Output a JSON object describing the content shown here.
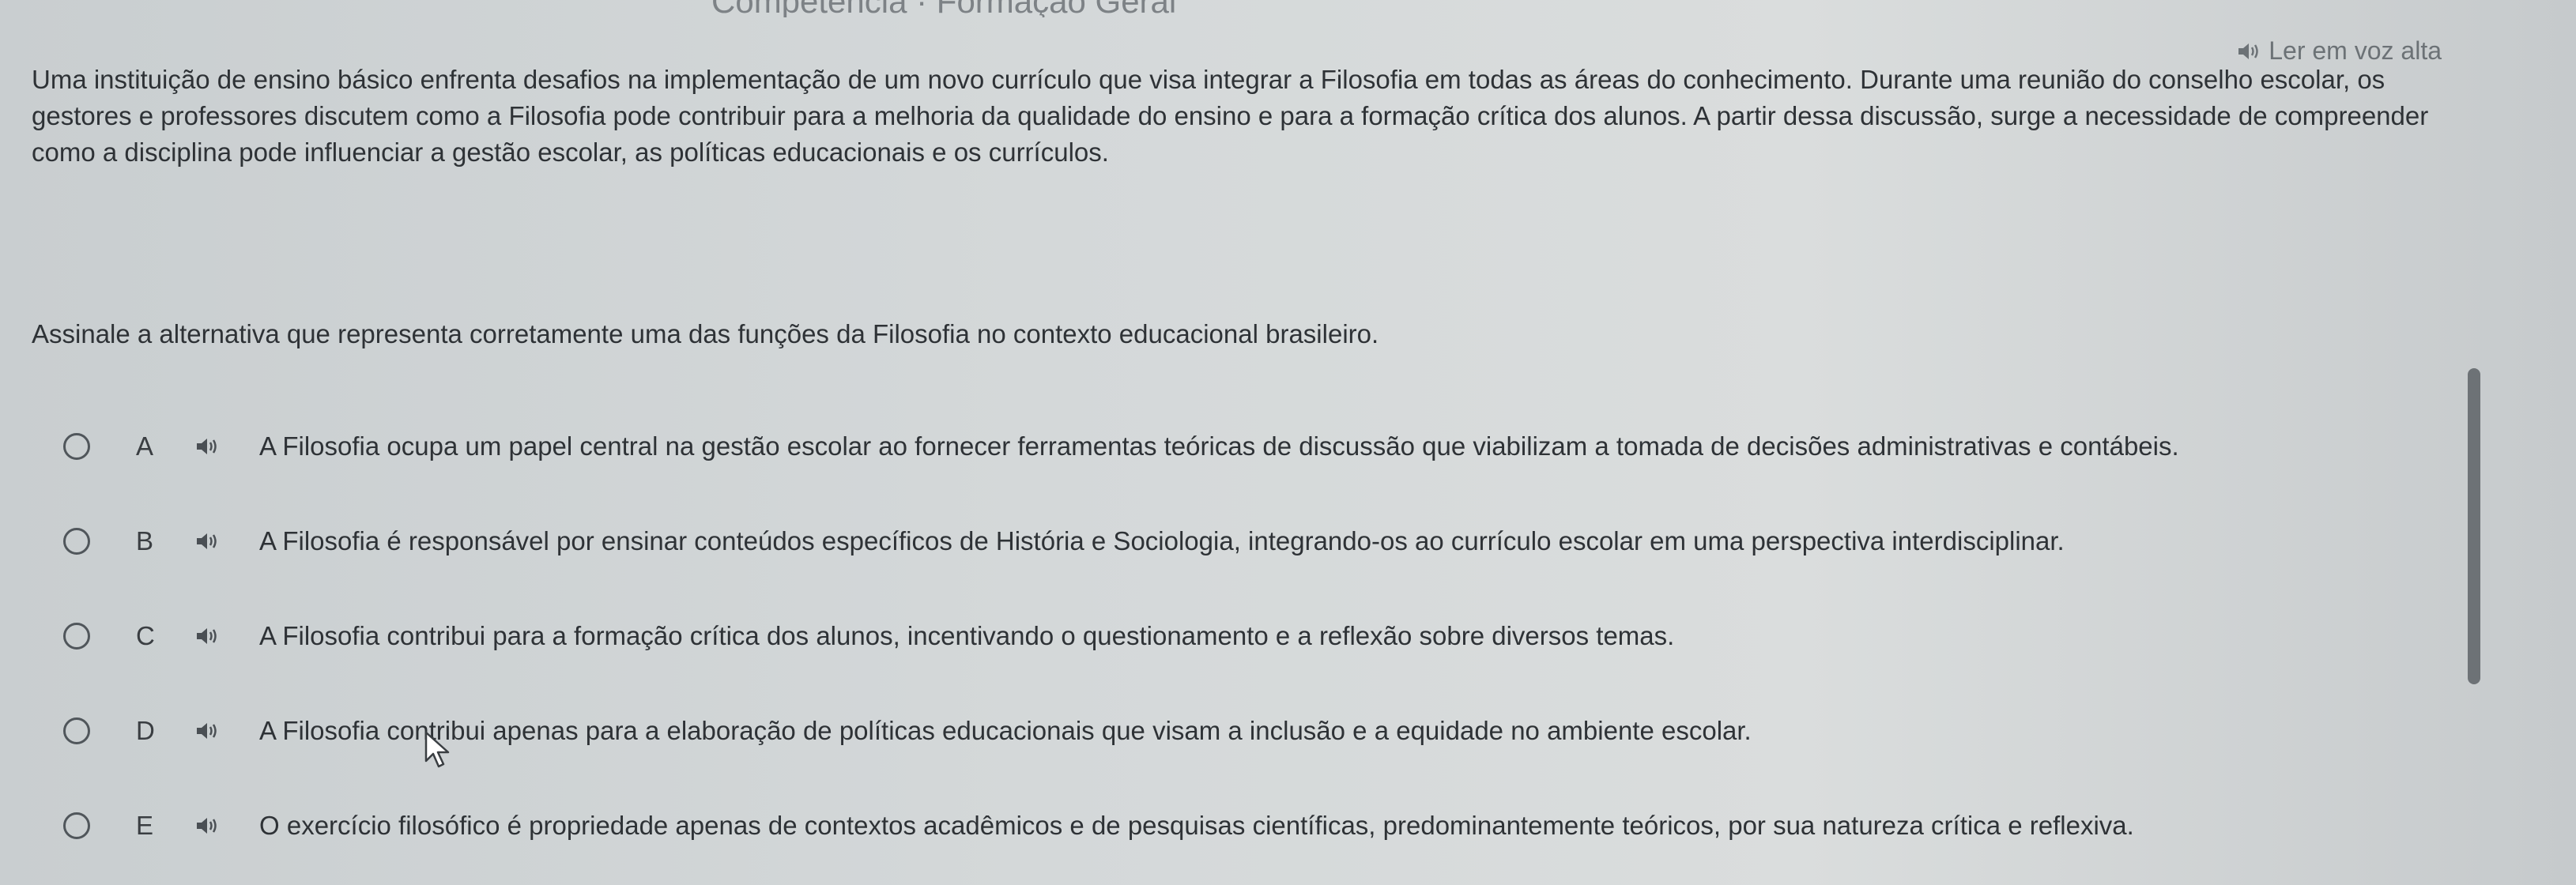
{
  "header": {
    "breadcrumb": "Competência · Formação Geral",
    "read_aloud_label": "Ler em voz alta"
  },
  "question": {
    "statement": "Uma instituição de ensino básico enfrenta desafios na implementação de um novo currículo que visa integrar a Filosofia em todas as áreas do conhecimento. Durante uma reunião do conselho escolar, os gestores e professores discutem como a Filosofia pode contribuir para a melhoria da qualidade do ensino e para a formação crítica dos alunos. A partir dessa discussão, surge a necessidade de compreender como a disciplina pode influenciar a gestão escolar, as políticas educacionais e os currículos.",
    "prompt": "Assinale a alternativa que representa corretamente uma das funções da Filosofia no contexto educacional brasileiro."
  },
  "options": [
    {
      "letter": "A",
      "text": "A Filosofia ocupa um papel central na gestão escolar ao fornecer ferramentas teóricas de discussão que viabilizam a tomada de decisões administrativas e contábeis."
    },
    {
      "letter": "B",
      "text": "A Filosofia é responsável por ensinar conteúdos específicos de História e Sociologia, integrando-os ao currículo escolar em uma perspectiva interdisciplinar."
    },
    {
      "letter": "C",
      "text": "A Filosofia contribui para a formação crítica dos alunos, incentivando o questionamento e a reflexão sobre diversos temas."
    },
    {
      "letter": "D",
      "text": "A Filosofia contribui apenas para a elaboração de políticas educacionais que visam a inclusão e a equidade no ambiente escolar."
    },
    {
      "letter": "E",
      "text": "O exercício filosófico é propriedade apenas de contextos acadêmicos e de pesquisas científicas, predominantemente teóricos, por sua natureza crítica e reflexiva."
    }
  ],
  "icons": {
    "speaker": "speaker-icon",
    "cursor": "mouse-pointer-icon",
    "arrow": "arrow-right-icon"
  },
  "colors": {
    "background": "#d4d8d9",
    "text": "#2e3236",
    "muted": "#6c7276"
  }
}
